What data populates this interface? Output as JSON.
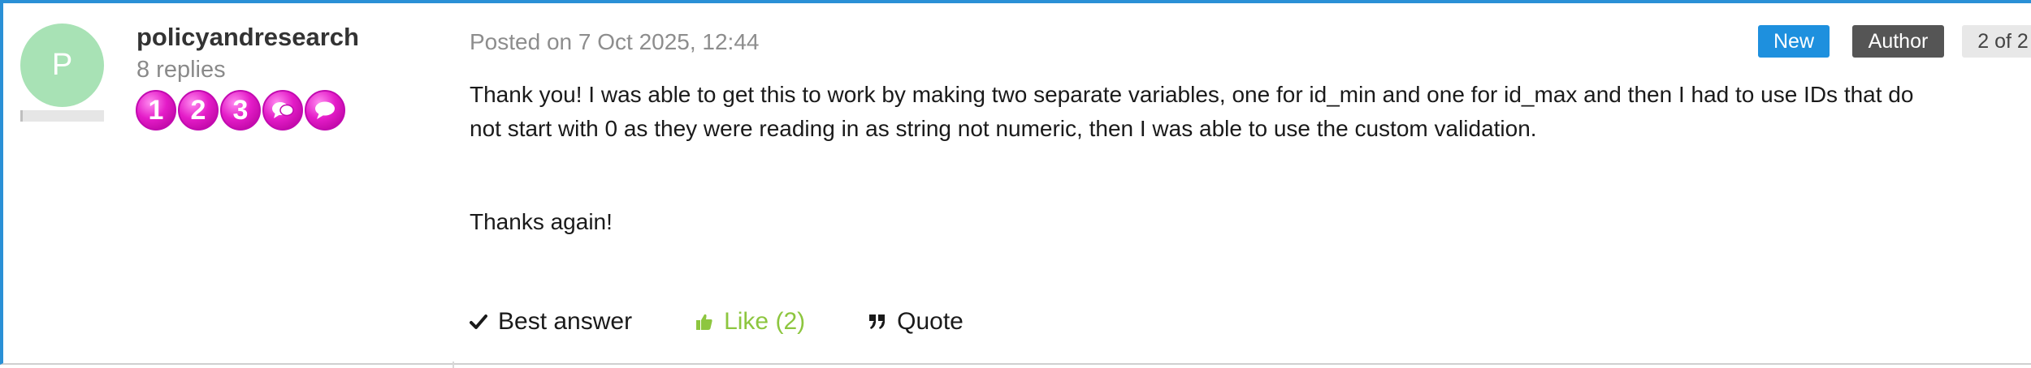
{
  "author": {
    "avatar_letter": "P",
    "avatar_color": "#a8e2b5",
    "username": "policyandresearch",
    "replies": "8 replies",
    "badges": [
      {
        "label": "1",
        "icon": "rank-badge-1"
      },
      {
        "label": "2",
        "icon": "rank-badge-2"
      },
      {
        "label": "3",
        "icon": "rank-badge-3"
      },
      {
        "label": "",
        "icon": "speech-bubbles-badge"
      },
      {
        "label": "",
        "icon": "speech-bubble-badge"
      }
    ],
    "badge_color": "#e41cc8"
  },
  "post": {
    "posted": "Posted on 7 Oct 2025, 12:44",
    "tags": {
      "new": "New",
      "author": "Author",
      "count": "2 of 2"
    },
    "paragraphs": [
      "Thank you! I was able to get this to work by making two separate variables, one for id_min and one for id_max and then I had to use IDs that do not start with 0 as they were reading in as string not numeric, then I was able to use the custom validation.",
      "Thanks again!"
    ],
    "actions": {
      "best_answer": "Best answer",
      "like": "Like (2)",
      "quote": "Quote"
    }
  },
  "colors": {
    "accent": "#2a90d6",
    "new_tag": "#1e90de",
    "author_tag": "#555555",
    "like": "#8dc63f"
  }
}
